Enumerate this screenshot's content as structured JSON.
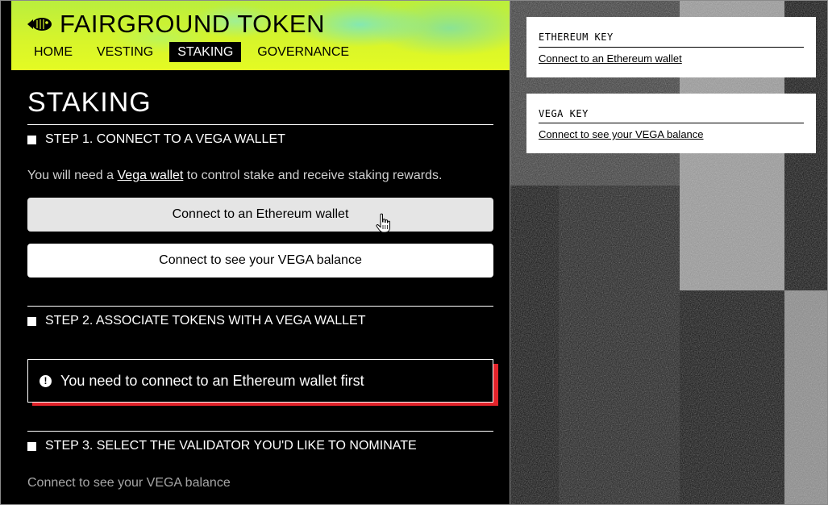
{
  "header": {
    "brand": "FAIRGROUND TOKEN",
    "nav": [
      {
        "label": "HOME"
      },
      {
        "label": "VESTING"
      },
      {
        "label": "STAKING",
        "active": true
      },
      {
        "label": "GOVERNANCE"
      }
    ]
  },
  "main": {
    "title": "STAKING",
    "step1": {
      "heading": "STEP 1. CONNECT TO A VEGA WALLET",
      "helper_prefix": "You will need a ",
      "helper_link": "Vega wallet",
      "helper_suffix": " to control stake and receive staking rewards.",
      "eth_button": "Connect to an Ethereum wallet",
      "vega_button": "Connect to see your VEGA balance"
    },
    "step2": {
      "heading": "STEP 2. ASSOCIATE TOKENS WITH A VEGA WALLET",
      "error_icon": "!",
      "error_text": "You need to connect to an Ethereum wallet first"
    },
    "step3": {
      "heading": "STEP 3. SELECT THE VALIDATOR YOU'D LIKE TO NOMINATE",
      "link": "Connect to see your VEGA balance"
    }
  },
  "sidebar": {
    "ethereum_card": {
      "title": "ETHEREUM KEY",
      "link": "Connect to an Ethereum wallet"
    },
    "vega_card": {
      "title": "VEGA KEY",
      "link": "Connect to see your VEGA balance"
    }
  },
  "colors": {
    "accent": "#d8f52a",
    "error": "#e3242b"
  },
  "icons": [
    "fish-logo-icon",
    "hand-pointer-cursor-icon",
    "alert-icon"
  ]
}
